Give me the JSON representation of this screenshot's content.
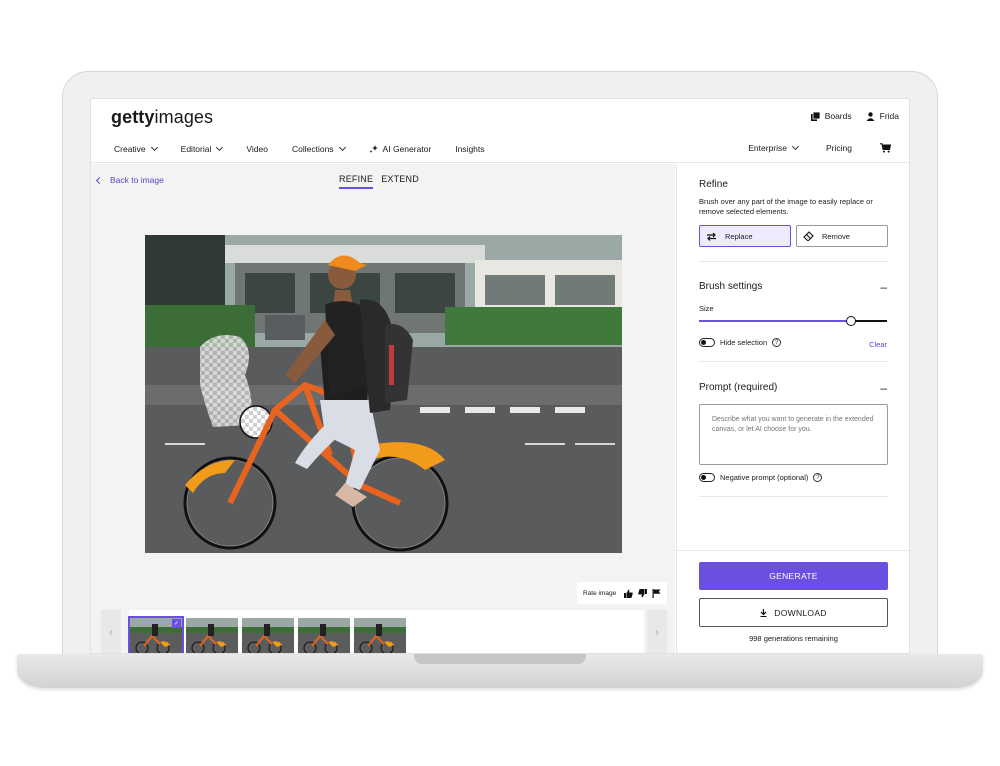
{
  "header": {
    "logo_bold": "getty",
    "logo_light": "images",
    "boards_label": "Boards",
    "user_label": "Frida",
    "nav": [
      {
        "label": "Creative"
      },
      {
        "label": "Editorial"
      },
      {
        "label": "Video"
      },
      {
        "label": "Collections"
      },
      {
        "label": "AI Generator"
      },
      {
        "label": "Insights"
      }
    ],
    "enterprise_label": "Enterprise",
    "pricing_label": "Pricing"
  },
  "work": {
    "back_label": "Back to image",
    "tabs": [
      {
        "label": "REFINE"
      },
      {
        "label": "EXTEND"
      }
    ],
    "rate_label": "Rate image"
  },
  "panel": {
    "refine_title": "Refine",
    "refine_desc": "Brush over any part of the image to easily replace or remove selected elements.",
    "replace_label": "Replace",
    "remove_label": "Remove",
    "brush_title": "Brush settings",
    "size_label": "Size",
    "size_value": 0.81,
    "hide_selection_label": "Hide selection",
    "clear_label": "Clear",
    "prompt_title": "Prompt (required)",
    "prompt_placeholder": "Describe what you want to generate in the extended canvas, or let AI choose for you.",
    "negative_prompt_label": "Negative prompt (optional)",
    "generate_label": "GENERATE",
    "download_label": "DOWNLOAD",
    "remaining_label": "998 generations remaining"
  },
  "colors": {
    "accent": "#6b4fe0",
    "link": "#5a43c9"
  }
}
